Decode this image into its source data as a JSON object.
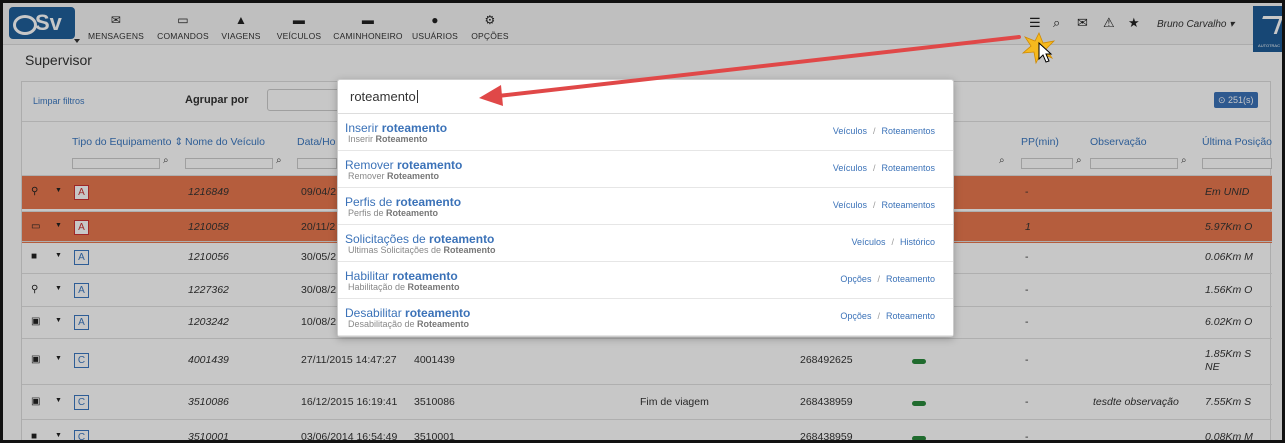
{
  "app": {
    "logo_text": "Sv",
    "page_title": "Supervisor"
  },
  "nav": [
    {
      "label": "MENSAGENS",
      "icon": "envelope-icon",
      "glyph": "✉"
    },
    {
      "label": "COMANDOS",
      "icon": "laptop-icon",
      "glyph": "▭"
    },
    {
      "label": "VIAGENS",
      "icon": "road-icon",
      "glyph": "▲"
    },
    {
      "label": "VEÍCULOS",
      "icon": "car-icon",
      "glyph": "▬"
    },
    {
      "label": "CAMINHONEIRO",
      "icon": "truck-icon",
      "glyph": "▬"
    },
    {
      "label": "USUÁRIOS",
      "icon": "user-icon",
      "glyph": "●"
    },
    {
      "label": "OPÇÕES",
      "icon": "gears-icon",
      "glyph": "⚙"
    }
  ],
  "topbar": {
    "user_name": "Bruno Carvalho",
    "icons": [
      "list-icon",
      "search-icon",
      "inbox-icon",
      "alert-icon",
      "star-icon"
    ],
    "brand_text": "AUTOTRAC"
  },
  "toolbar": {
    "clear_filters": "Limpar filtros",
    "group_by": "Agrupar por",
    "count_badge": "⊙ 251(s)"
  },
  "columns": [
    "Tipo do Equipamento",
    "Nome do Veículo",
    "Data/Ho",
    "PP(min)",
    "Observação",
    "Última Posição"
  ],
  "rows": [
    {
      "highlight": true,
      "vehicle_icon": "motorcycle-icon",
      "type": "A",
      "name": "1216849",
      "date": "09/04/2",
      "id": "",
      "event": "",
      "phone": "",
      "key": false,
      "pp": "-",
      "obs": "",
      "pos": "Em UNID"
    },
    {
      "highlight": true,
      "vehicle_icon": "bed-icon",
      "type": "A",
      "name": "1210058",
      "date": "20/11/2",
      "id": "",
      "event": "",
      "phone": "",
      "key": false,
      "pp": "1",
      "obs": "",
      "pos": "5.97Km O"
    },
    {
      "highlight": false,
      "vehicle_icon": "truck-icon",
      "type": "A",
      "name": "1210056",
      "date": "30/05/2",
      "id": "",
      "event": "",
      "phone": "",
      "key": false,
      "pp": "-",
      "obs": "",
      "pos": "0.06Km M"
    },
    {
      "highlight": false,
      "vehicle_icon": "motorcycle-icon",
      "type": "A",
      "name": "1227362",
      "date": "30/08/2",
      "id": "",
      "event": "",
      "phone": "",
      "key": false,
      "pp": "-",
      "obs": "",
      "pos": "1.56Km O"
    },
    {
      "highlight": false,
      "vehicle_icon": "bus-icon",
      "type": "A",
      "name": "1203242",
      "date": "10/08/2",
      "id": "",
      "event": "",
      "phone": "",
      "key": false,
      "pp": "-",
      "obs": "",
      "pos": "6.02Km O"
    },
    {
      "highlight": false,
      "vehicle_icon": "bus-icon",
      "type": "C",
      "name": "4001439",
      "date": "27/11/2015 14:47:27",
      "id": "4001439",
      "event": "",
      "phone": "268492625",
      "key": true,
      "pp": "-",
      "obs": "",
      "pos": "1.85Km S",
      "pos2": "NE"
    },
    {
      "highlight": false,
      "vehicle_icon": "bus-icon",
      "type": "C",
      "name": "3510086",
      "date": "16/12/2015 16:19:41",
      "id": "3510086",
      "event": "Fim de viagem",
      "phone": "268438959",
      "key": true,
      "pp": "-",
      "obs": "tesdte observação",
      "pos": "7.55Km S"
    },
    {
      "highlight": false,
      "vehicle_icon": "truck-icon",
      "type": "C",
      "name": "3510001",
      "date": "03/06/2014 16:54:49",
      "id": "3510001",
      "event": "",
      "phone": "268438959",
      "key": true,
      "pp": "-",
      "obs": "",
      "pos": "0.08Km M"
    }
  ],
  "search": {
    "query": "roteamento",
    "results": [
      {
        "pre": "Inserir ",
        "bold": "roteamento",
        "sub_pre": "Inserir ",
        "sub_bold": "Roteamento",
        "path1": "Veículos",
        "path2": "Roteamentos"
      },
      {
        "pre": "Remover ",
        "bold": "roteamento",
        "sub_pre": "Remover ",
        "sub_bold": "Roteamento",
        "path1": "Veículos",
        "path2": "Roteamentos"
      },
      {
        "pre": "Perfis de ",
        "bold": "roteamento",
        "sub_pre": "Perfis de ",
        "sub_bold": "Roteamento",
        "path1": "Veículos",
        "path2": "Roteamentos"
      },
      {
        "pre": "Solicitações de ",
        "bold": "roteamento",
        "sub_pre": "Ultimas Solicitações de ",
        "sub_bold": "Roteamento",
        "path1": "Veículos",
        "path2": "Histórico"
      },
      {
        "pre": "Habilitar ",
        "bold": "roteamento",
        "sub_pre": "Habilitação de ",
        "sub_bold": "Roteamento",
        "path1": "Opções",
        "path2": "Roteamento"
      },
      {
        "pre": "Desabilitar ",
        "bold": "roteamento",
        "sub_pre": "Desabilitação de ",
        "sub_bold": "Roteamento",
        "path1": "Opções",
        "path2": "Roteamento"
      }
    ]
  },
  "colors": {
    "accent": "#3b72b8",
    "highlight_row": "#e8784f",
    "arrow": "#e04848",
    "key": "#2a8a3b"
  }
}
